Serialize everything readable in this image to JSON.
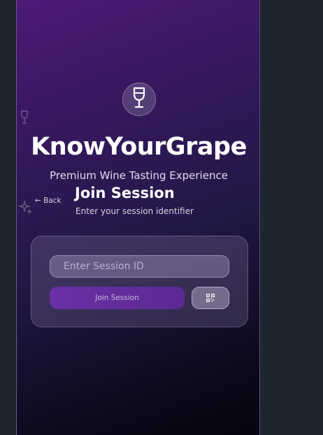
{
  "app": {
    "title": "KnowYourGrape",
    "subtitle": "Premium Wine Tasting Experience"
  },
  "nav": {
    "back_label": "← Back"
  },
  "join": {
    "heading": "Join Session",
    "subheading": "Enter your session identifier",
    "input_placeholder": "Enter Session ID",
    "input_value": "",
    "button_label": "Join Session"
  },
  "icons": {
    "logo": "wine-glass-icon",
    "qr": "qr-code-icon",
    "decor_glass": "wine-glass-icon",
    "decor_sparkle": "sparkle-icon"
  },
  "colors": {
    "accent": "#6a30a6",
    "background": "#1f2530",
    "gradient_top": "#4d1a78",
    "gradient_bottom": "#050410"
  }
}
